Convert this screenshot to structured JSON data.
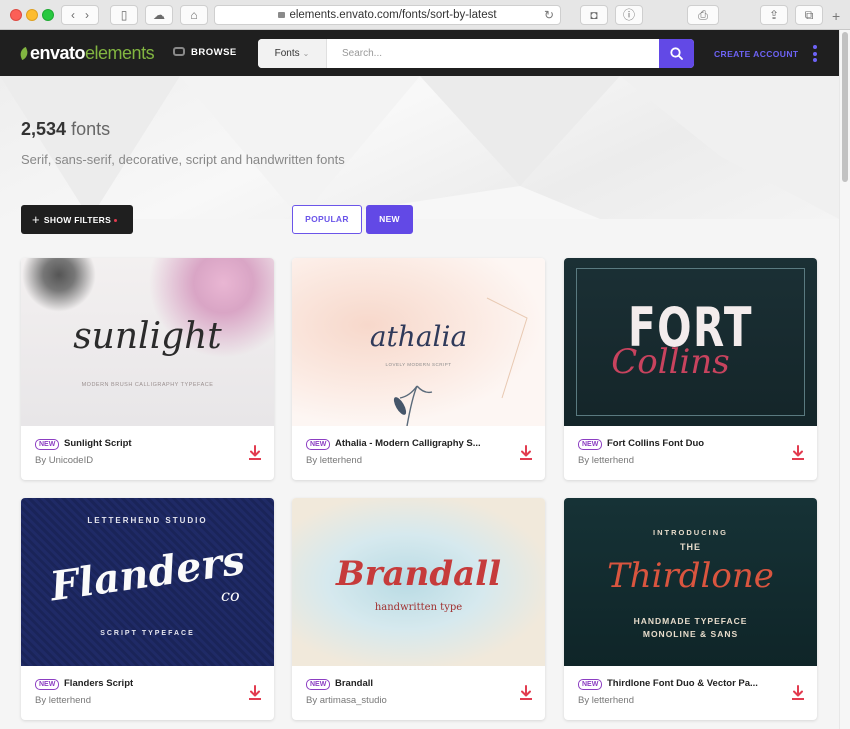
{
  "browser": {
    "url": "elements.envato.com/fonts/sort-by-latest"
  },
  "header": {
    "logo_main": "envato",
    "logo_accent": "elements",
    "browse_label": "BROWSE",
    "search_category": "Fonts",
    "search_placeholder": "Search...",
    "create_account": "CREATE ACCOUNT"
  },
  "hero": {
    "count": "2,534",
    "count_unit": "fonts",
    "subtitle": "Serif, sans-serif, decorative, script and handwritten fonts"
  },
  "filters": {
    "show_filters": "SHOW FILTERS",
    "popular": "POPULAR",
    "new": "NEW"
  },
  "cards": [
    {
      "badge": "NEW",
      "title": "Sunlight Script",
      "author": "By UnicodeID",
      "thumb_text": "sunlight",
      "thumb_sub": "MODERN BRUSH CALLIGRAPHY TYPEFACE"
    },
    {
      "badge": "NEW",
      "title": "Athalia - Modern Calligraphy S...",
      "author": "By letterhend",
      "thumb_text": "athalia",
      "thumb_sub": "LOVELY MODERN SCRIPT"
    },
    {
      "badge": "NEW",
      "title": "Fort Collins Font Duo",
      "author": "By letterhend",
      "thumb_text": "FORT",
      "thumb_sub": "Collins"
    },
    {
      "badge": "NEW",
      "title": "Flanders Script",
      "author": "By letterhend",
      "thumb_text": "Flanders",
      "thumb_sub": "co",
      "thumb_top": "LETTERHEND STUDIO",
      "thumb_bottom": "SCRIPT TYPEFACE"
    },
    {
      "badge": "NEW",
      "title": "Brandall",
      "author": "By artimasa_studio",
      "thumb_text": "Brandall",
      "thumb_sub": "handwritten type"
    },
    {
      "badge": "NEW",
      "title": "Thirdlone Font Duo & Vector Pa...",
      "author": "By letterhend",
      "thumb_text": "Thirdlone",
      "thumb_top": "INTRODUCING",
      "thumb_the": "THE",
      "thumb_sub": "HANDMADE TYPEFACE",
      "thumb_bottom": "MONOLINE & SANS"
    }
  ]
}
